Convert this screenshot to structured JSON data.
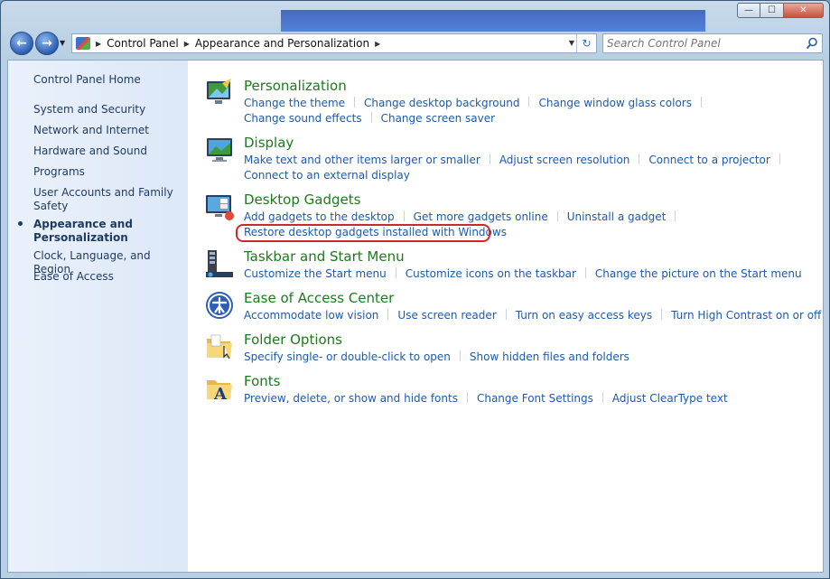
{
  "window": {
    "minimize": "—",
    "maximize": "☐",
    "close": "✕"
  },
  "nav": {
    "back_icon": "arrow-left-icon",
    "forward_icon": "arrow-right-icon",
    "breadcrumbs": [
      "Control Panel",
      "Appearance and Personalization"
    ],
    "search_placeholder": "Search Control Panel"
  },
  "sidebar": {
    "home": "Control Panel Home",
    "items": [
      "System and Security",
      "Network and Internet",
      "Hardware and Sound",
      "Programs",
      "User Accounts and Family Safety",
      "Appearance and Personalization",
      "Clock, Language, and Region",
      "Ease of Access"
    ],
    "active_index": 5
  },
  "categories": [
    {
      "title": "Personalization",
      "icon": "personalization-icon",
      "links": [
        "Change the theme",
        "Change desktop background",
        "Change window glass colors",
        "Change sound effects",
        "Change screen saver"
      ]
    },
    {
      "title": "Display",
      "icon": "display-icon",
      "links": [
        "Make text and other items larger or smaller",
        "Adjust screen resolution",
        "Connect to a projector",
        "Connect to an external display"
      ]
    },
    {
      "title": "Desktop Gadgets",
      "icon": "gadgets-icon",
      "links": [
        "Add gadgets to the desktop",
        "Get more gadgets online",
        "Uninstall a gadget",
        "Restore desktop gadgets installed with Windows"
      ]
    },
    {
      "title": "Taskbar and Start Menu",
      "icon": "taskbar-icon",
      "links": [
        "Customize the Start menu",
        "Customize icons on the taskbar",
        "Change the picture on the Start menu"
      ]
    },
    {
      "title": "Ease of Access Center",
      "icon": "ease-of-access-icon",
      "links": [
        "Accommodate low vision",
        "Use screen reader",
        "Turn on easy access keys",
        "Turn High Contrast on or off"
      ]
    },
    {
      "title": "Folder Options",
      "icon": "folder-options-icon",
      "links": [
        "Specify single- or double-click to open",
        "Show hidden files and folders"
      ]
    },
    {
      "title": "Fonts",
      "icon": "fonts-icon",
      "links": [
        "Preview, delete, or show and hide fonts",
        "Change Font Settings",
        "Adjust ClearType text"
      ]
    }
  ],
  "colors": {
    "link": "#1e5aa8",
    "category_title": "#1d7a1d",
    "highlight_annotation": "#d1262a"
  }
}
